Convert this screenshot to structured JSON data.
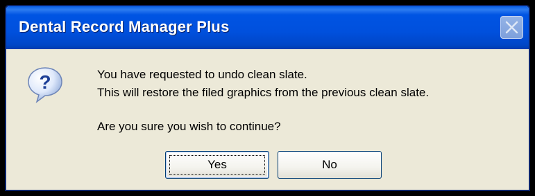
{
  "window": {
    "title": "Dental Record Manager Plus",
    "close_label": "Close",
    "icon": "question-icon"
  },
  "message": {
    "line1": "You have requested to undo clean slate.",
    "line2": "This will restore the filed graphics from the previous clean slate.",
    "line3": "Are you sure you wish to continue?"
  },
  "buttons": {
    "yes_label": "Yes",
    "no_label": "No"
  },
  "colors": {
    "titlebar": "#0054e3",
    "dialog_background": "#ece9d8",
    "button_border": "#003c74"
  }
}
